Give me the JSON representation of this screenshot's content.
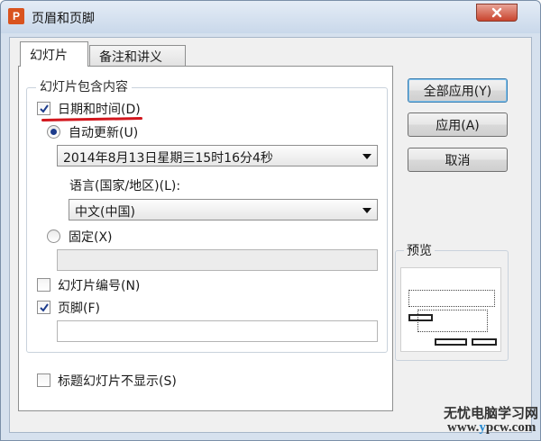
{
  "window": {
    "title": "页眉和页脚",
    "app_icon_letter": "P"
  },
  "tabs": [
    {
      "label": "幻灯片",
      "active": true
    },
    {
      "label": "备注和讲义",
      "active": false
    }
  ],
  "group": {
    "title": "幻灯片包含内容",
    "date_time": {
      "label": "日期和时间(D)",
      "checked": true
    },
    "auto_update": {
      "label": "自动更新(U)",
      "selected": true,
      "value": "2014年8月13日星期三15时16分4秒"
    },
    "language": {
      "label": "语言(国家/地区)(L):",
      "value": "中文(中国)"
    },
    "fixed": {
      "label": "固定(X)",
      "selected": false,
      "value": ""
    },
    "slide_number": {
      "label": "幻灯片编号(N)",
      "checked": false
    },
    "footer": {
      "label": "页脚(F)",
      "checked": true,
      "value": ""
    }
  },
  "hide_on_title": {
    "label": "标题幻灯片不显示(S)",
    "checked": false
  },
  "buttons": {
    "apply_all": "全部应用(Y)",
    "apply": "应用(A)",
    "cancel": "取消"
  },
  "preview": {
    "title": "预览"
  },
  "watermark": {
    "line1": "无忧电脑学习网",
    "line2_prefix": "www.",
    "line2_y": "y",
    "line2_rest": "pcw.com"
  },
  "colors": {
    "accent": "#3c7fb1",
    "annotation_underline": "#d2161d",
    "close_button": "#c9442d"
  }
}
